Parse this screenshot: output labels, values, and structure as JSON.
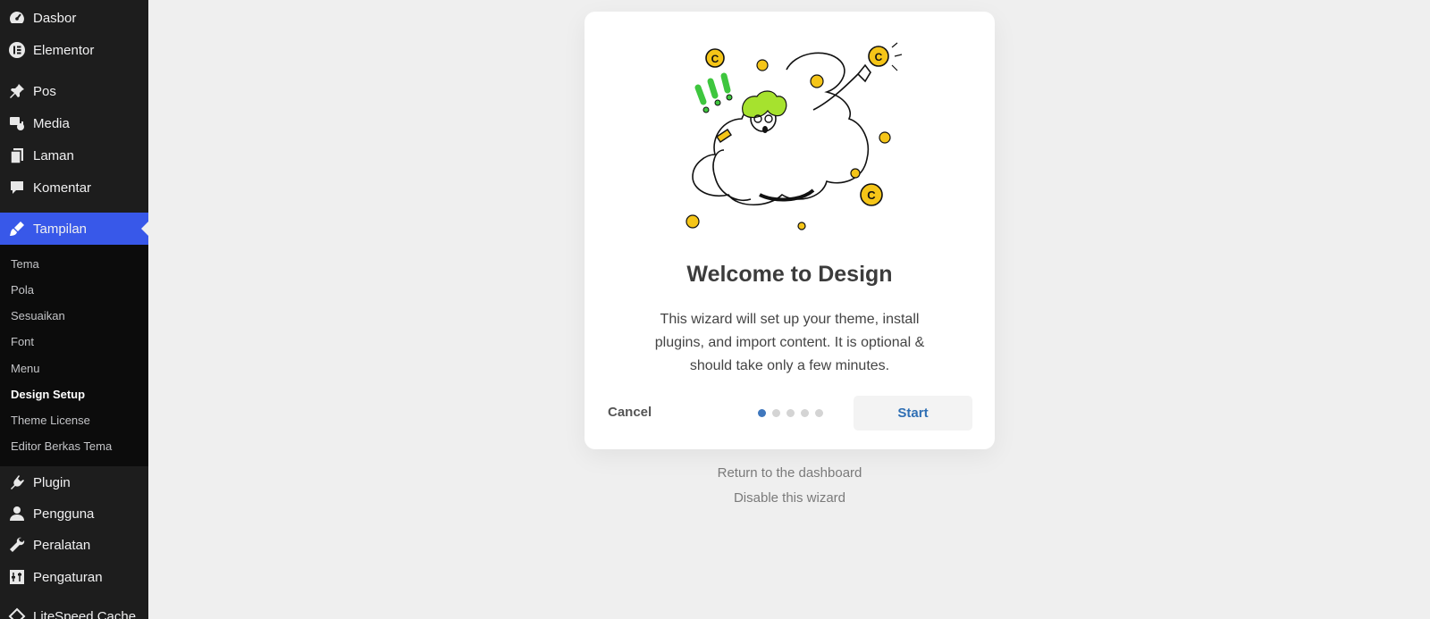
{
  "sidebar": {
    "items": [
      {
        "label": "Dasbor",
        "icon": "dashboard-icon"
      },
      {
        "label": "Elementor",
        "icon": "elementor-icon"
      },
      {
        "label": "Pos",
        "icon": "pin-icon"
      },
      {
        "label": "Media",
        "icon": "media-icon"
      },
      {
        "label": "Laman",
        "icon": "page-icon"
      },
      {
        "label": "Komentar",
        "icon": "comment-icon"
      },
      {
        "label": "Tampilan",
        "icon": "brush-icon"
      },
      {
        "label": "Plugin",
        "icon": "plugin-icon"
      },
      {
        "label": "Pengguna",
        "icon": "user-icon"
      },
      {
        "label": "Peralatan",
        "icon": "wrench-icon"
      },
      {
        "label": "Pengaturan",
        "icon": "settings-icon"
      },
      {
        "label": "LiteSpeed Cache",
        "icon": "litespeed-icon"
      }
    ],
    "submenu": [
      "Tema",
      "Pola",
      "Sesuaikan",
      "Font",
      "Menu",
      "Design Setup",
      "Theme License",
      "Editor Berkas Tema"
    ],
    "accent": "#3858e9"
  },
  "wizard": {
    "title": "Welcome to Design",
    "description": "This wizard will set up your theme, install plugins, and import content. It is optional & should take only a few minutes.",
    "cancel_label": "Cancel",
    "start_label": "Start",
    "step_current": 1,
    "step_total": 5
  },
  "links": {
    "return": "Return to the dashboard",
    "disable": "Disable this wizard"
  }
}
